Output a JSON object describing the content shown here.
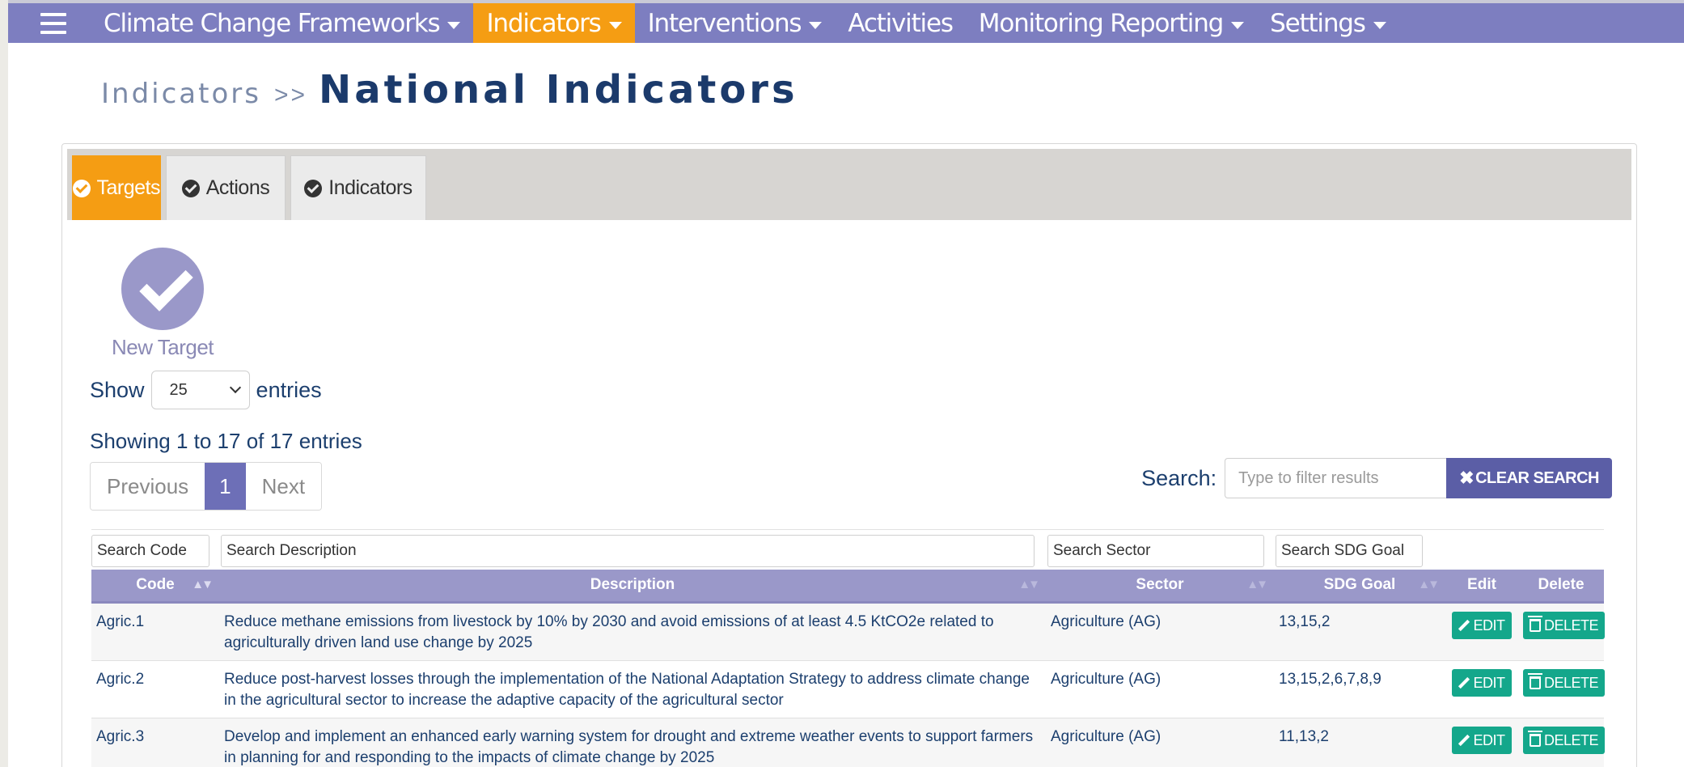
{
  "nav": {
    "items": [
      {
        "label": "Climate Change Frameworks",
        "caret": true,
        "active": false
      },
      {
        "label": "Indicators",
        "caret": true,
        "active": true
      },
      {
        "label": "Interventions",
        "caret": true,
        "active": false
      },
      {
        "label": "Activities",
        "caret": false,
        "active": false
      },
      {
        "label": "Monitoring Reporting",
        "caret": true,
        "active": false
      },
      {
        "label": "Settings",
        "caret": true,
        "active": false
      }
    ]
  },
  "breadcrumb": {
    "parent": "Indicators",
    "separator": ">>",
    "title": "National Indicators"
  },
  "tabs": [
    {
      "label": "Targets",
      "active": true
    },
    {
      "label": "Actions",
      "active": false
    },
    {
      "label": "Indicators",
      "active": false
    }
  ],
  "new_target": {
    "label": "New Target"
  },
  "length": {
    "show": "Show",
    "value": "25",
    "entries": "entries"
  },
  "info": "Showing 1 to 17 of 17 entries",
  "pagination": {
    "previous": "Previous",
    "current": "1",
    "next": "Next"
  },
  "search": {
    "label": "Search:",
    "placeholder": "Type to filter results",
    "clear": "CLEAR SEARCH"
  },
  "filters": {
    "code": "Search Code",
    "description": "Search Description",
    "sector": "Search Sector",
    "sdg": "Search SDG Goal"
  },
  "columns": {
    "code": "Code",
    "description": "Description",
    "sector": "Sector",
    "sdg": "SDG Goal",
    "edit": "Edit",
    "delete": "Delete"
  },
  "buttons": {
    "edit": "EDIT",
    "delete": "DELETE"
  },
  "rows": [
    {
      "code": "Agric.1",
      "description": "Reduce methane emissions from livestock by 10% by 2030 and avoid emissions of at least 4.5 KtCO2e related to agriculturally driven land use change by 2025",
      "sector": "Agriculture (AG)",
      "sdg": "13,15,2"
    },
    {
      "code": "Agric.2",
      "description": "Reduce post-harvest losses through the implementation of the National Adaptation Strategy to address climate change in the agricultural sector to increase the adaptive capacity of the agricultural sector",
      "sector": "Agriculture (AG)",
      "sdg": "13,15,2,6,7,8,9"
    },
    {
      "code": "Agric.3",
      "description": "Develop and implement an enhanced early warning system for drought and extreme weather events to support farmers in planning for and responding to the impacts of climate change by 2025",
      "sector": "Agriculture (AG)",
      "sdg": "11,13,2"
    }
  ],
  "colors": {
    "nav": "#7d7ec0",
    "accent": "#f59d13",
    "header": "#9a98c9",
    "button": "#14a78b",
    "text": "#1c3f6e"
  }
}
